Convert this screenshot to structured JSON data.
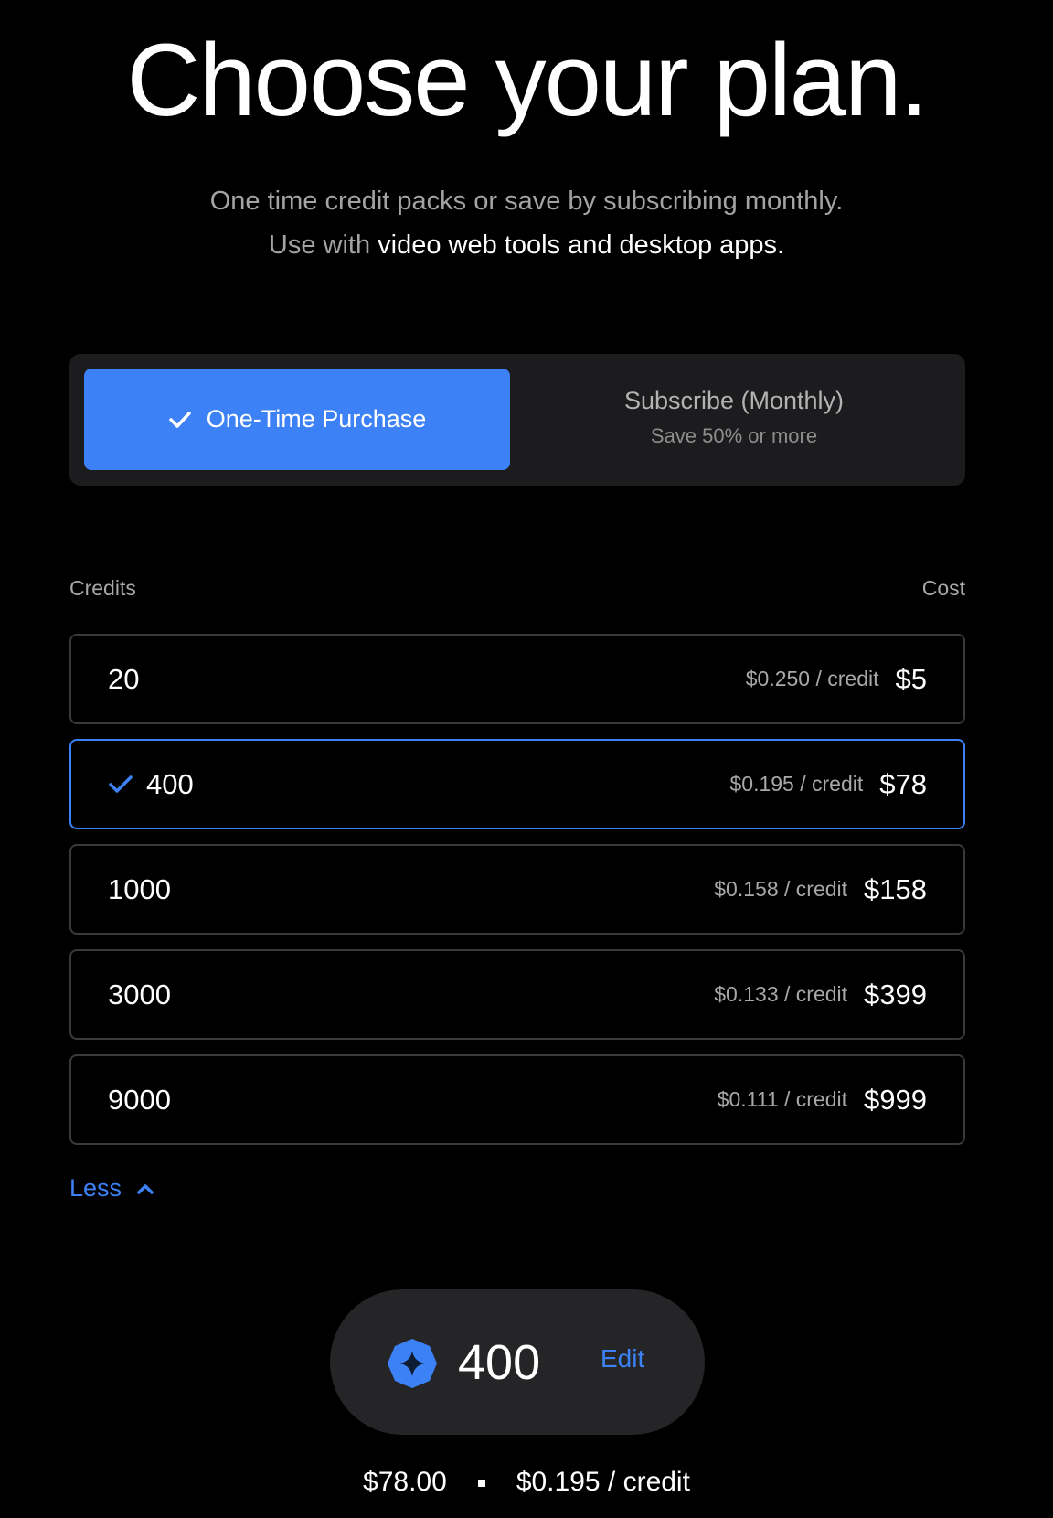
{
  "header": {
    "title": "Choose your plan.",
    "subtitle_line1": "One time credit packs or save by subscribing monthly.",
    "subtitle_line2_prefix": "Use with ",
    "subtitle_line2_highlight": "video web tools and desktop apps."
  },
  "toggle": {
    "one_time_label": "One-Time Purchase",
    "subscribe_label": "Subscribe (Monthly)",
    "subscribe_sublabel": "Save 50% or more",
    "selected": "One-Time Purchase"
  },
  "table": {
    "credits_header": "Credits",
    "cost_header": "Cost",
    "rows": [
      {
        "credits": "20",
        "per_credit": "$0.250 / credit",
        "cost": "$5",
        "selected": false
      },
      {
        "credits": "400",
        "per_credit": "$0.195 / credit",
        "cost": "$78",
        "selected": true
      },
      {
        "credits": "1000",
        "per_credit": "$0.158 / credit",
        "cost": "$158",
        "selected": false
      },
      {
        "credits": "3000",
        "per_credit": "$0.133 / credit",
        "cost": "$399",
        "selected": false
      },
      {
        "credits": "9000",
        "per_credit": "$0.111 / credit",
        "cost": "$999",
        "selected": false
      }
    ]
  },
  "less_label": "Less",
  "selection": {
    "amount": "400",
    "edit_label": "Edit",
    "total": "$78.00",
    "per_credit": "$0.195 / credit"
  },
  "colors": {
    "accent": "#3c82f6",
    "background": "#000000",
    "panel": "#1c1c1e"
  }
}
